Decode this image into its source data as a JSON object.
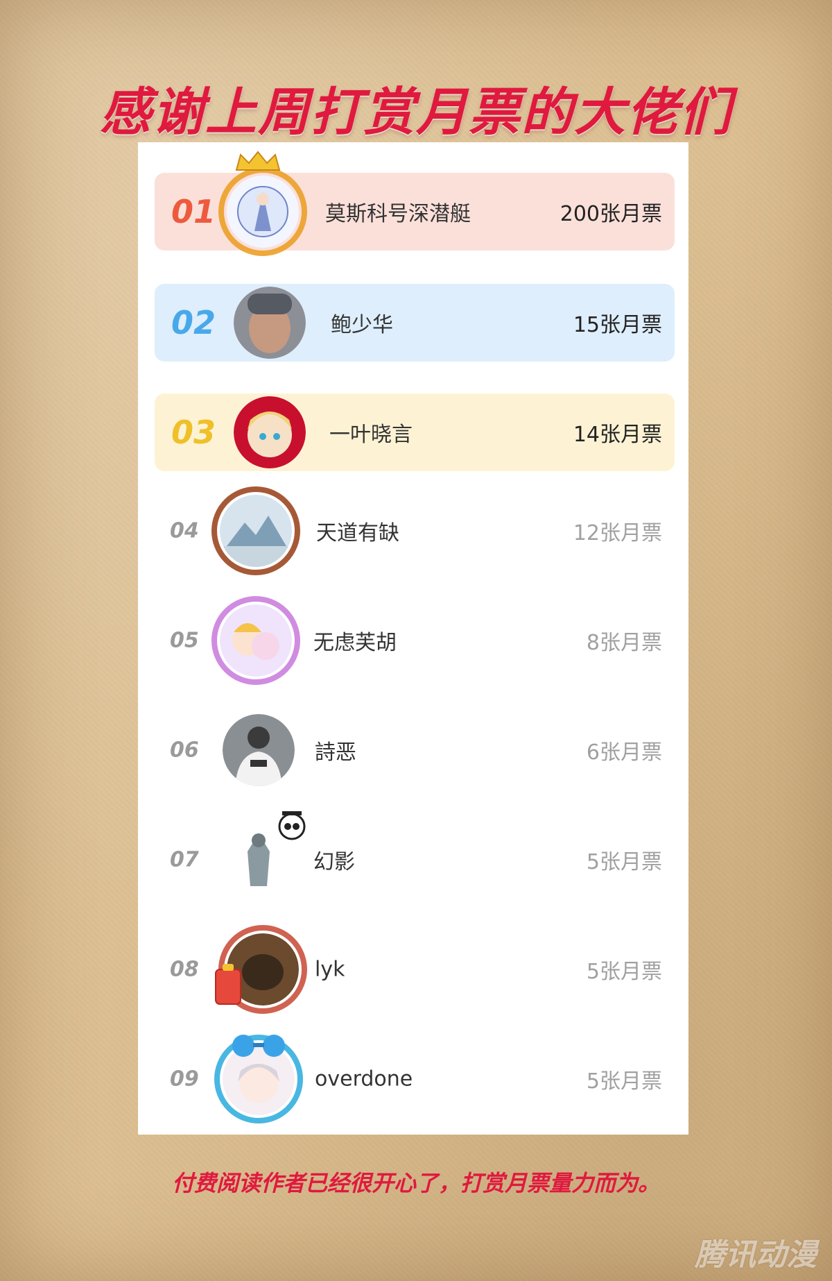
{
  "header": {
    "title": "感谢上周打赏月票的大佬们"
  },
  "colors": {
    "accent": "#e0193e",
    "rank1_bg": "#fbe0da",
    "rank1_num": "#ee5a3e",
    "rank2_bg": "#deeefc",
    "rank2_num": "#49a8ea",
    "rank3_bg": "#fdf3d4",
    "rank3_num": "#f0c02a",
    "other_num": "#9a9a9a"
  },
  "leaderboard": [
    {
      "rank": "01",
      "name": "莫斯科号深潜艇",
      "votes": "200张月票",
      "avatar_icon": "anime-frame-avatar-icon"
    },
    {
      "rank": "02",
      "name": "鲍少华",
      "votes": "15张月票",
      "avatar_icon": "photo-avatar-icon"
    },
    {
      "rank": "03",
      "name": "一叶晓言",
      "votes": "14张月票",
      "avatar_icon": "anime-girl-avatar-icon"
    },
    {
      "rank": "04",
      "name": "天道有缺",
      "votes": "12张月票",
      "avatar_icon": "landscape-frame-avatar-icon"
    },
    {
      "rank": "05",
      "name": "无虑芙胡",
      "votes": "8张月票",
      "avatar_icon": "anime-frame-avatar-icon"
    },
    {
      "rank": "06",
      "name": "詩恶",
      "votes": "6张月票",
      "avatar_icon": "photo-avatar-icon"
    },
    {
      "rank": "07",
      "name": "幻影",
      "votes": "5张月票",
      "avatar_icon": "figure-frame-avatar-icon"
    },
    {
      "rank": "08",
      "name": "lyk",
      "votes": "5张月票",
      "avatar_icon": "fortune-frame-avatar-icon"
    },
    {
      "rank": "09",
      "name": "overdone",
      "votes": "5张月票",
      "avatar_icon": "anime-girl-avatar-icon"
    }
  ],
  "footer": {
    "note": "付费阅读作者已经很开心了，打赏月票量力而为。"
  },
  "watermark": {
    "text": "腾讯动漫"
  }
}
